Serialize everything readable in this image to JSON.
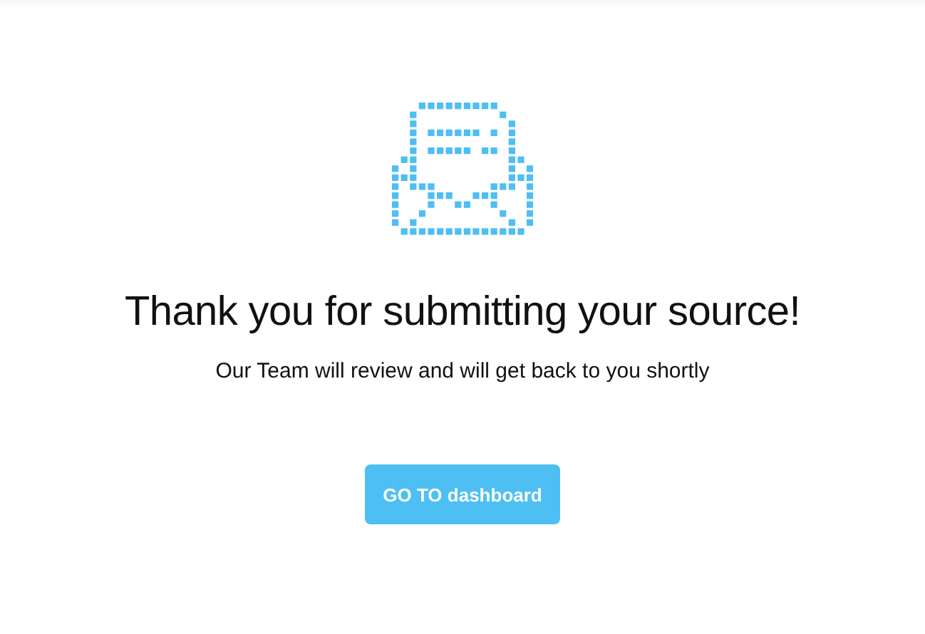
{
  "heading": "Thank you for submitting your source!",
  "message": "Our Team will review and will get back to you shortly",
  "button": {
    "label": "GO TO dashboard"
  }
}
